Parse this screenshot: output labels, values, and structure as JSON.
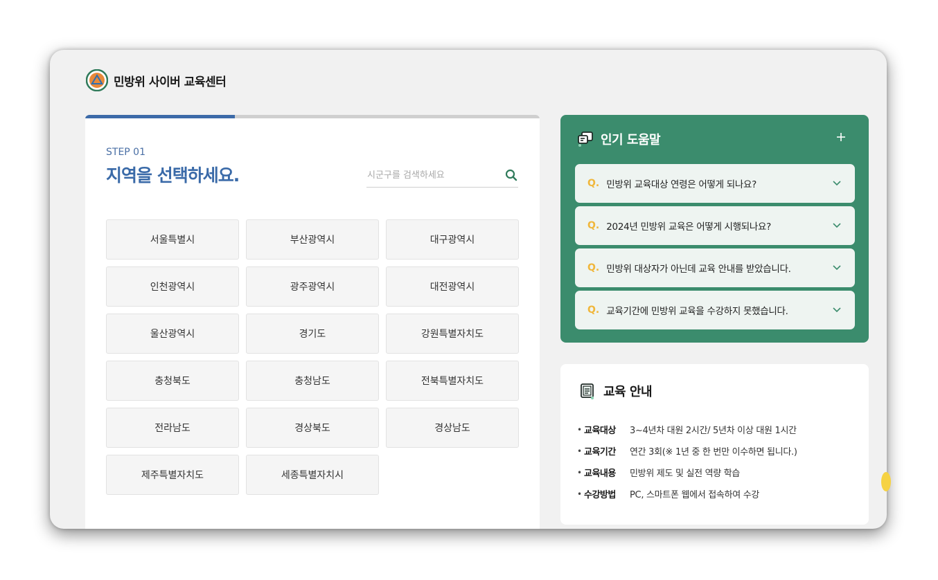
{
  "app": {
    "title": "민방위 사이버 교육센터"
  },
  "step": {
    "label": "STEP 01",
    "title": "지역을 선택하세요.",
    "progress_percent": 33
  },
  "search": {
    "placeholder": "시군구를 검색하세요",
    "value": ""
  },
  "regions": [
    "서울특별시",
    "부산광역시",
    "대구광역시",
    "인천광역시",
    "광주광역시",
    "대전광역시",
    "울산광역시",
    "경기도",
    "강원특별자치도",
    "충청북도",
    "충청남도",
    "전북특별자치도",
    "전라남도",
    "경상북도",
    "경상남도",
    "제주특별자치도",
    "세종특별자치시"
  ],
  "faq": {
    "title": "인기 도움말",
    "prefix": "Q.",
    "items": [
      "민방위 교육대상 연령은 어떻게 되나요?",
      "2024년 민방위 교육은 어떻게 시행되나요?",
      "민방위 대상자가 아닌데 교육 안내를 받았습니다.",
      "교육기간에 민방위 교육을 수강하지 못했습니다."
    ]
  },
  "info": {
    "title": "교육 안내",
    "rows": [
      {
        "label": "교육대상",
        "value": "3~4년차 대원 2시간/ 5년차 이상 대원 1시간"
      },
      {
        "label": "교육기간",
        "value": "연간 3회(※ 1년 중 한 번만 이수하면 됩니다.)"
      },
      {
        "label": "교육내용",
        "value": "민방위 제도 및 실전 역량 학습"
      },
      {
        "label": "수강방법",
        "value": "PC, 스마트폰 웹에서 접속하여 수강"
      }
    ]
  },
  "colors": {
    "accent_blue": "#3a6aa8",
    "faq_green": "#3b8c6d",
    "q_yellow": "#f0b73c"
  }
}
